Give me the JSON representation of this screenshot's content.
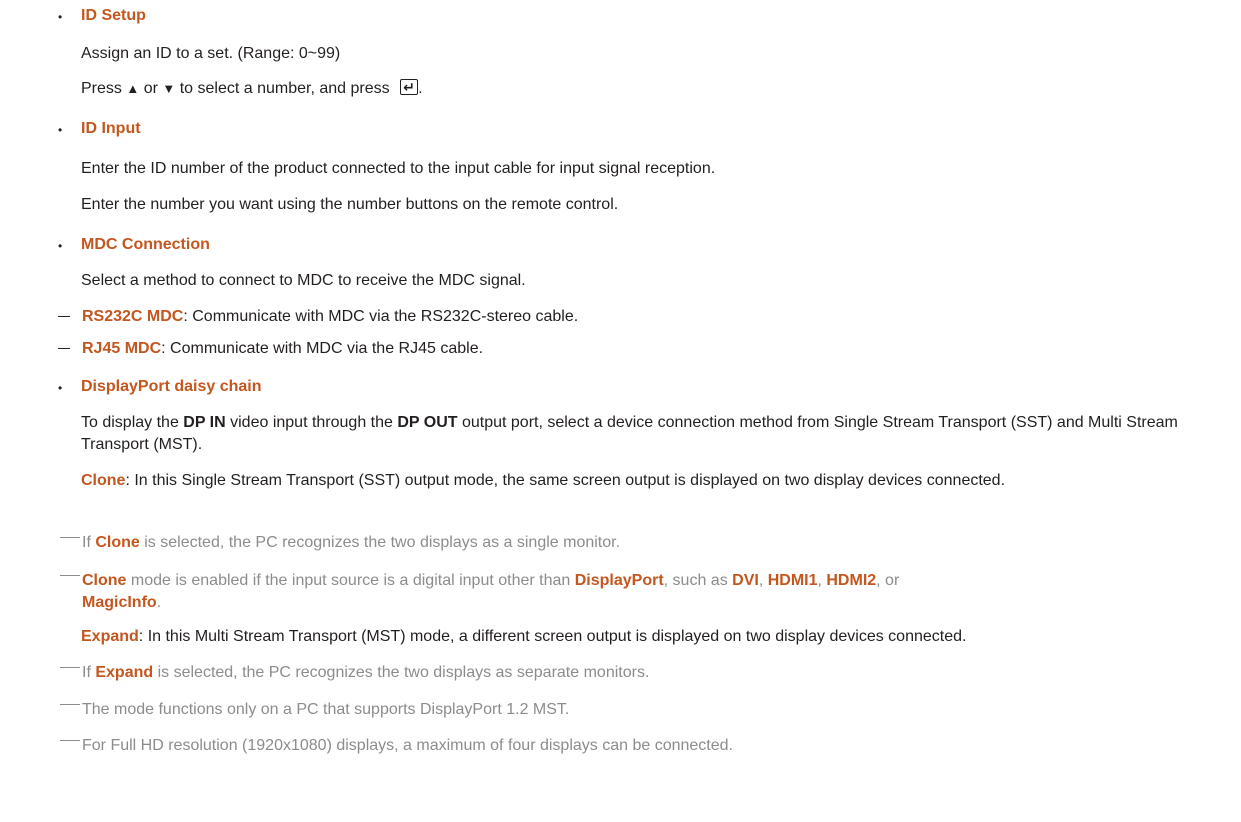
{
  "sections": [
    {
      "title": "ID Setup",
      "lines": [
        "Assign an ID to a set. (Range: 0~99)"
      ],
      "press": {
        "a": "Press",
        "up": "▲",
        "or": "or",
        "down": "▼",
        "b": "to select a number, and press",
        "end": "."
      }
    },
    {
      "title": "ID Input",
      "lines": [
        "Enter the ID number of the product connected to the input cable for input signal reception.",
        "Enter the number you want using the number buttons on the remote control."
      ]
    },
    {
      "title": "MDC Connection",
      "lines": [
        "Select a method to connect to MDC to receive the MDC signal."
      ],
      "options": [
        {
          "name": "RS232C MDC",
          "desc": ": Communicate with MDC via the RS232C-stereo cable."
        },
        {
          "name": "RJ45 MDC",
          "desc": ": Communicate with MDC via the RJ45 cable."
        }
      ]
    },
    {
      "title": "DisplayPort daisy chain",
      "intro": {
        "a": "To display the ",
        "dp_in": "DP IN",
        "b": " video input through the ",
        "dp_out": "DP OUT",
        "c": " output port, select a device connection method from Single Stream Transport (SST) and Multi Stream Transport (MST)."
      },
      "clone": {
        "name": "Clone",
        "desc": ": In this Single Stream Transport (SST) output mode, the same screen output is displayed on two display devices connected."
      },
      "clone_notes": [
        {
          "a": "If ",
          "b": "Clone",
          "c": " is selected, the PC recognizes the two displays as a single monitor."
        },
        {
          "a": "",
          "b": "Clone",
          "c": " mode is enabled if the input source is a digital input other than ",
          "d": "DisplayPort",
          "e": ", such as ",
          "f": "DVI",
          "g": ", ",
          "h": "HDMI1",
          "i": ", ",
          "j": "HDMI2",
          "k": ", or ",
          "l": "MagicInfo",
          "m": "."
        }
      ],
      "expand": {
        "name": "Expand",
        "desc": ": In this Multi Stream Transport (MST) mode, a different screen output is displayed on two display devices connected."
      },
      "expand_notes": [
        {
          "a": "If ",
          "b": "Expand",
          "c": " is selected, the PC recognizes the two displays as separate monitors."
        },
        {
          "text": "The mode functions only on a PC that supports DisplayPort 1.2 MST."
        },
        {
          "text": "For Full HD resolution (1920x1080) displays, a maximum of four displays can be connected."
        }
      ]
    }
  ]
}
